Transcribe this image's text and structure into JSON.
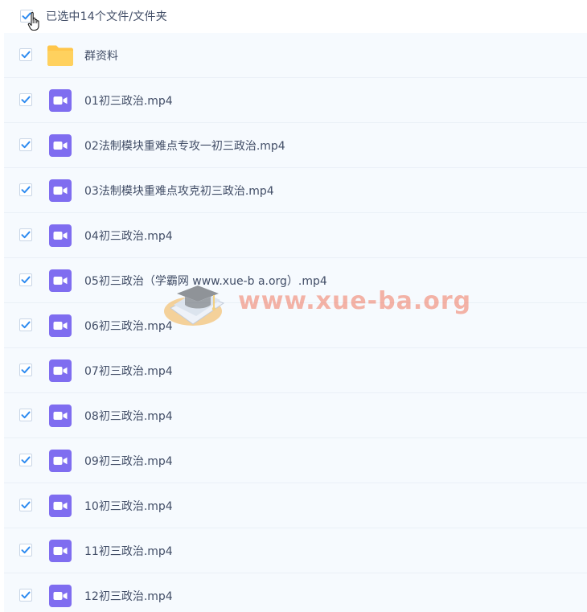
{
  "header": {
    "selection_text": "已选中14个文件/文件夹"
  },
  "watermark": {
    "text": "www.xue-ba.org"
  },
  "colors": {
    "check": "#2e8bf0",
    "folder": "#ffc64a",
    "video": "#7f6df0",
    "text": "#424e67",
    "row_bg": "#f6fafe"
  },
  "files": [
    {
      "name": "群资料",
      "icon": "folder-icon"
    },
    {
      "name": "01初三政治.mp4",
      "icon": "video-file-icon"
    },
    {
      "name": "02法制模块重难点专攻一初三政治.mp4",
      "icon": "video-file-icon"
    },
    {
      "name": "03法制模块重难点攻克初三政治.mp4",
      "icon": "video-file-icon"
    },
    {
      "name": "04初三政治.mp4",
      "icon": "video-file-icon"
    },
    {
      "name": "05初三政治（学霸网 www.xue-b a.org）.mp4",
      "icon": "video-file-icon"
    },
    {
      "name": "06初三政治.mp4",
      "icon": "video-file-icon"
    },
    {
      "name": "07初三政治.mp4",
      "icon": "video-file-icon"
    },
    {
      "name": "08初三政治.mp4",
      "icon": "video-file-icon"
    },
    {
      "name": "09初三政治.mp4",
      "icon": "video-file-icon"
    },
    {
      "name": "10初三政治.mp4",
      "icon": "video-file-icon"
    },
    {
      "name": "11初三政治.mp4",
      "icon": "video-file-icon"
    },
    {
      "name": "12初三政治.mp4",
      "icon": "video-file-icon"
    }
  ]
}
